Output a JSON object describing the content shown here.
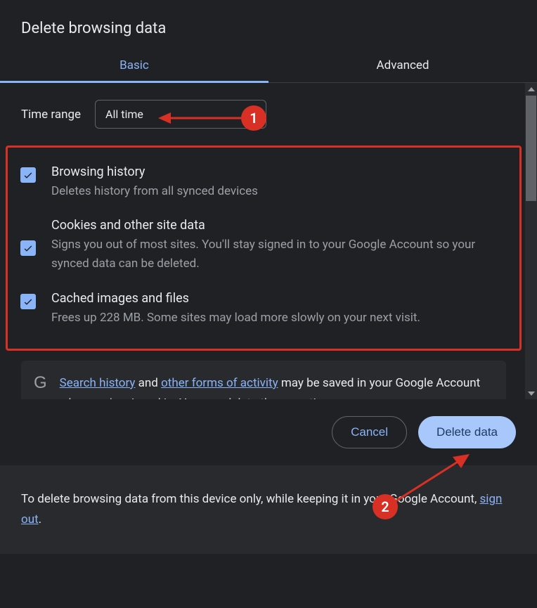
{
  "title": "Delete browsing data",
  "tabs": {
    "basic": "Basic",
    "advanced": "Advanced"
  },
  "timeRange": {
    "label": "Time range",
    "value": "All time"
  },
  "options": {
    "history": {
      "title": "Browsing history",
      "desc": "Deletes history from all synced devices"
    },
    "cookies": {
      "title": "Cookies and other site data",
      "desc": "Signs you out of most sites. You'll stay signed in to your Google Account so your synced data can be deleted."
    },
    "cache": {
      "title": "Cached images and files",
      "desc": "Frees up 228 MB. Some sites may load more slowly on your next visit."
    }
  },
  "info": {
    "link1": "Search history",
    "mid1": " and ",
    "link2": "other forms of activity",
    "tail": " may be saved in your Google Account when you're signed in. You can delete them anytime."
  },
  "buttons": {
    "cancel": "Cancel",
    "delete": "Delete data"
  },
  "footer": {
    "text1": "To delete browsing data from this device only, while keeping it in your Google Account, ",
    "link": "sign out",
    "text2": "."
  },
  "annotations": {
    "b1": "1",
    "b2": "2"
  }
}
